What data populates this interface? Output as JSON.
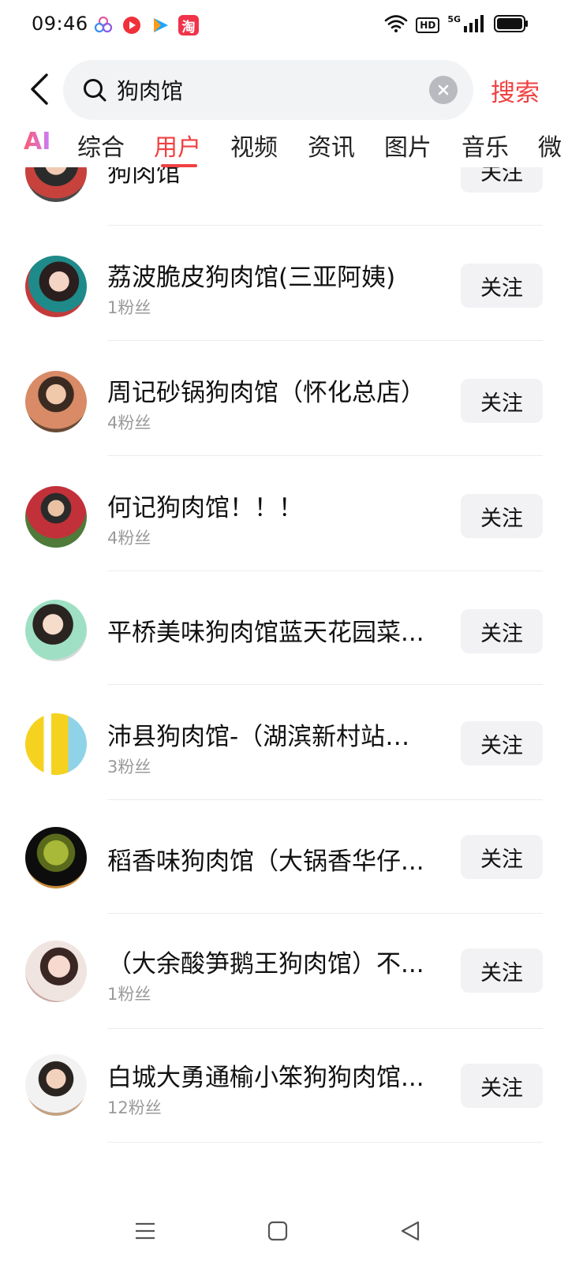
{
  "status_bar": {
    "time": "09:46",
    "hd_label": "HD",
    "network_label": "5G",
    "icons": [
      "app-clover-icon",
      "app-red-play-icon",
      "app-blue-play-icon",
      "app-taobao-icon",
      "wifi-icon",
      "signal-icon",
      "battery-icon"
    ],
    "taobao_char": "淘"
  },
  "header": {
    "search_value": "狗肉馆",
    "search_button": "搜索"
  },
  "tabs": [
    {
      "label": "AI"
    },
    {
      "label": "综合"
    },
    {
      "label": "用户",
      "active": true
    },
    {
      "label": "视频"
    },
    {
      "label": "资讯"
    },
    {
      "label": "图片"
    },
    {
      "label": "音乐"
    },
    {
      "label": "微"
    }
  ],
  "users": [
    {
      "name": "狗肉馆",
      "fans": ""
    },
    {
      "name": "荔波脆皮狗肉馆(三亚阿姨)",
      "fans": "1粉丝"
    },
    {
      "name": "周记砂锅狗肉馆（怀化总店）",
      "fans": "4粉丝"
    },
    {
      "name": "何记狗肉馆！！！",
      "fans": "4粉丝"
    },
    {
      "name": "平桥美味狗肉馆蓝天花园菜...",
      "fans": ""
    },
    {
      "name": "沛县狗肉馆-（湖滨新村站台...",
      "fans": "3粉丝"
    },
    {
      "name": "稻香味狗肉馆（大锅香华仔...",
      "fans": ""
    },
    {
      "name": "（大余酸笋鹅王狗肉馆）不...",
      "fans": "1粉丝"
    },
    {
      "name": "白城大勇通榆小笨狗狗肉馆...",
      "fans": "12粉丝"
    }
  ],
  "follow_label": "关注",
  "colors": {
    "accent": "#f04142",
    "search_bg": "#f2f3f5",
    "follow_bg": "#f2f2f4",
    "fans_text": "#9a9a9a"
  }
}
